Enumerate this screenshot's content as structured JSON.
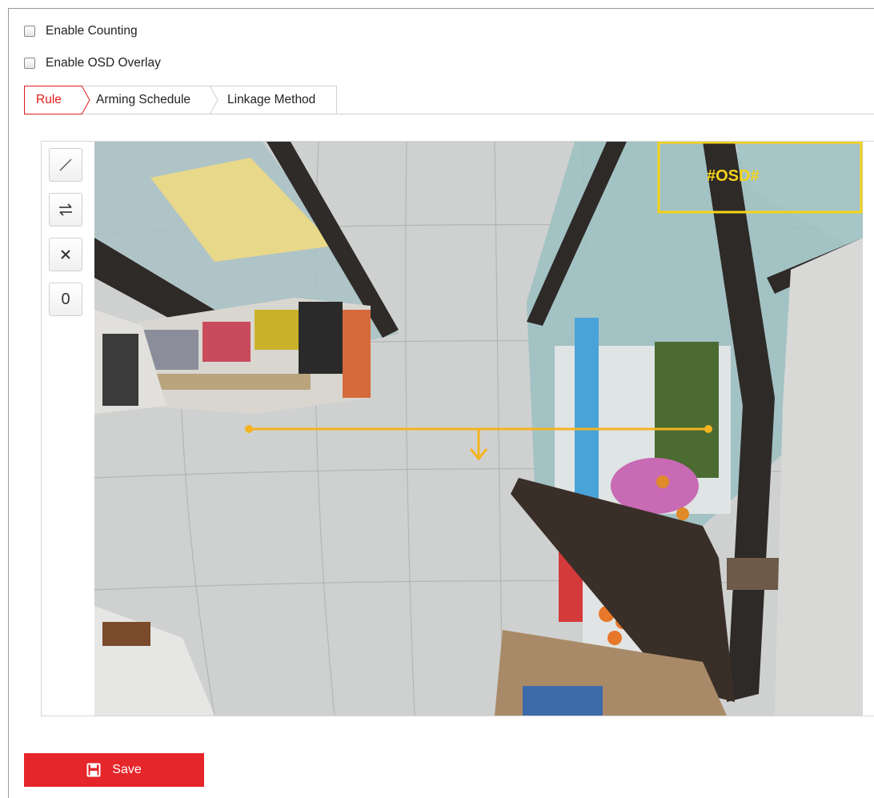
{
  "options": {
    "enable_counting_label": "Enable Counting",
    "enable_counting_checked": false,
    "enable_osd_label": "Enable OSD Overlay",
    "enable_osd_checked": false
  },
  "tabs": [
    {
      "label": "Rule",
      "active": true
    },
    {
      "label": "Arming Schedule",
      "active": false
    },
    {
      "label": "Linkage Method",
      "active": false
    }
  ],
  "toolbar": {
    "draw_line_icon": "draw-line-icon",
    "swap_direction_icon": "swap-direction-icon",
    "clear_icon": "clear-icon",
    "count_value": "0"
  },
  "video": {
    "osd_text": "#OSD#",
    "osd_color": "#f5d31a",
    "counting_line_color": "#f5b320"
  },
  "actions": {
    "save_label": "Save",
    "save_icon": "floppy-disk-icon",
    "save_color": "#e5262a",
    "accent_color": "#e21b1b"
  }
}
